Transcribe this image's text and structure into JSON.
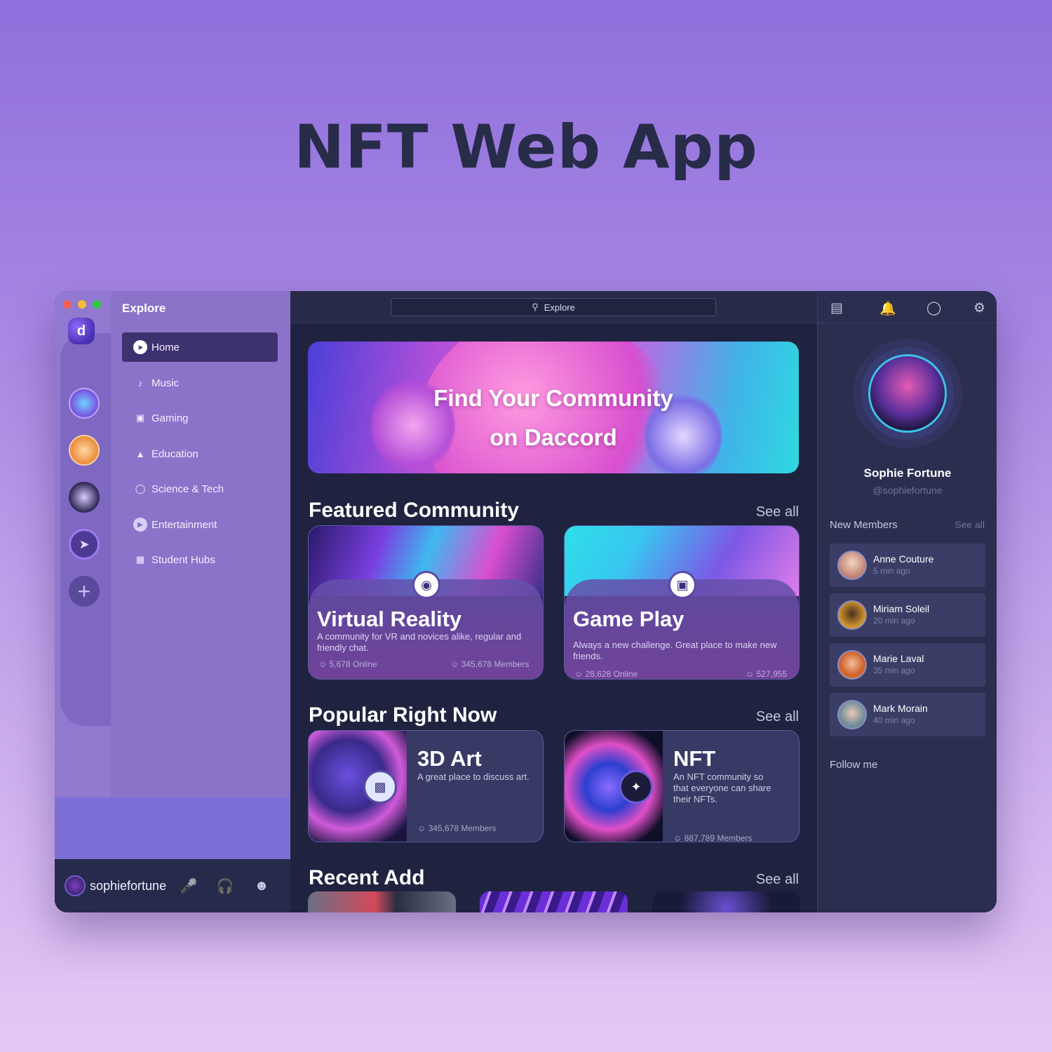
{
  "page": {
    "title": "NFT Web App"
  },
  "sidebar": {
    "title": "Explore",
    "items": [
      {
        "label": "Home",
        "icon": "compass-icon",
        "active": true
      },
      {
        "label": "Music",
        "icon": "music-note-icon"
      },
      {
        "label": "Gaming",
        "icon": "gamepad-icon"
      },
      {
        "label": "Education",
        "icon": "graduation-cap-icon"
      },
      {
        "label": "Science & Tech",
        "icon": "globe-icon"
      },
      {
        "label": "Entertainment",
        "icon": "play-icon"
      },
      {
        "label": "Student Hubs",
        "icon": "building-icon"
      }
    ]
  },
  "user": {
    "username": "sophiefortune"
  },
  "search": {
    "placeholder": "Explore"
  },
  "banner": {
    "line1": "Find Your Community",
    "line2": "on Daccord"
  },
  "featured": {
    "title": "Featured Community",
    "see_all": "See all",
    "cards": [
      {
        "title": "Virtual Reality",
        "desc": "A community for VR and novices alike, regular and friendly chat.",
        "online": "5,678 Online",
        "members": "345,678 Members"
      },
      {
        "title": "Game Play",
        "desc": "Always a new challenge. Great place to make new friends.",
        "online": "28,628 Online",
        "members": "527,955"
      }
    ]
  },
  "popular": {
    "title": "Popular Right Now",
    "see_all": "See all",
    "cards": [
      {
        "title": "3D Art",
        "desc": "A great place to discuss art.",
        "members": "345,678 Members"
      },
      {
        "title": "NFT",
        "desc": "An NFT community so that everyone can share their NFTs.",
        "members": "887,789 Members"
      }
    ]
  },
  "recent": {
    "title": "Recent Add",
    "see_all": "See all"
  },
  "profile": {
    "name": "Sophie Fortune",
    "handle": "@sophiefortune"
  },
  "new_members": {
    "title": "New Members",
    "see_all": "See all",
    "members": [
      {
        "name": "Anne Couture",
        "time": "5 min ago"
      },
      {
        "name": "Miriam Soleil",
        "time": "20 min ago"
      },
      {
        "name": "Marie Laval",
        "time": "35 min ago"
      },
      {
        "name": "Mark  Morain",
        "time": "40 min ago"
      }
    ]
  },
  "follow": "Follow me",
  "colors": {
    "accent": "#3e316f",
    "sidebar": "#8a73c9",
    "main_bg": "#1f2340",
    "panel": "#2a2e4f"
  }
}
